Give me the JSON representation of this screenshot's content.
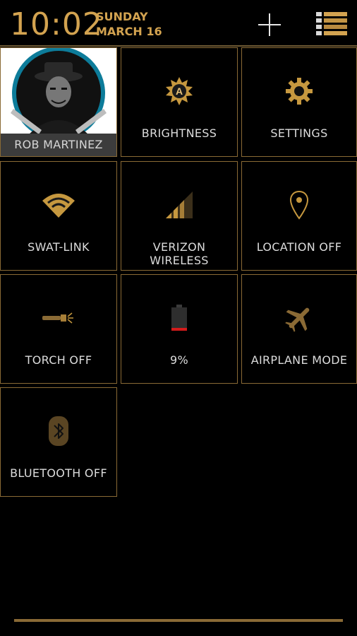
{
  "status": {
    "time": "10:02",
    "day": "SUNDAY",
    "date": "MARCH 16"
  },
  "colors": {
    "accent": "#d3a350",
    "tile_border": "#8a6a35",
    "background": "#000000",
    "battery_low": "#d31b1b"
  },
  "header_actions": {
    "add_icon": "plus-icon",
    "settings_list_icon": "list-icon"
  },
  "user": {
    "name": "ROB MARTINEZ"
  },
  "tiles": [
    {
      "label": "BRIGHTNESS",
      "icon": "brightness-icon"
    },
    {
      "label": "SETTINGS",
      "icon": "gear-icon"
    },
    {
      "label": "SWAT-LINK",
      "icon": "wifi-icon"
    },
    {
      "label": "VERIZON\nWIRELESS",
      "icon": "signal-icon"
    },
    {
      "label": "LOCATION OFF",
      "icon": "location-pin-icon"
    },
    {
      "label": "TORCH OFF",
      "icon": "torch-icon"
    },
    {
      "label": "9%",
      "icon": "battery-icon"
    },
    {
      "label": "AIRPLANE MODE",
      "icon": "airplane-icon"
    },
    {
      "label": "BLUETOOTH OFF",
      "icon": "bluetooth-icon"
    }
  ]
}
